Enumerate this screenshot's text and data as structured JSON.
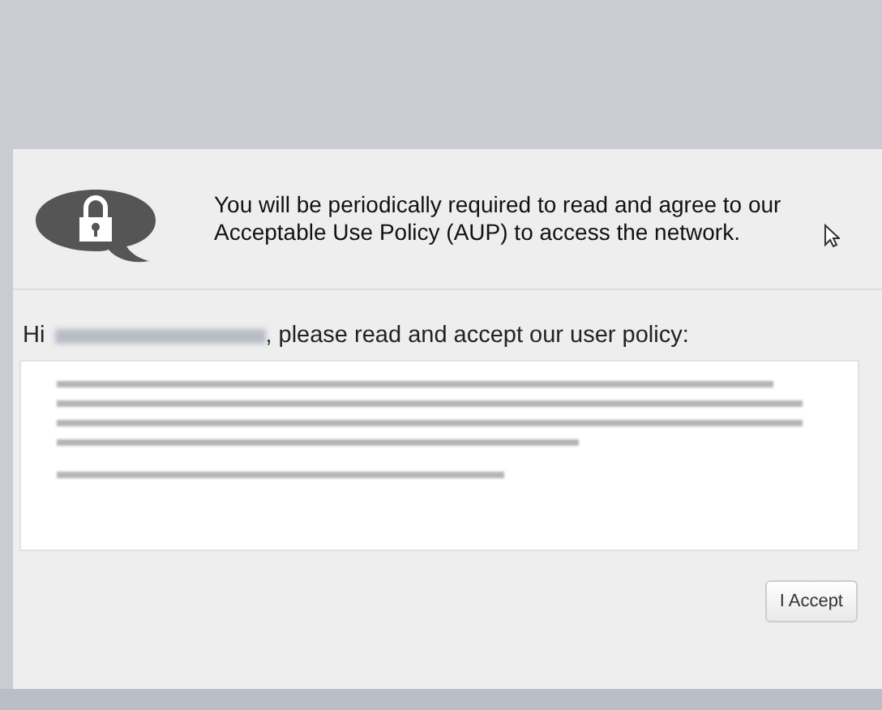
{
  "notice": {
    "text": "You will be periodically required to read and agree to our Acceptable Use Policy (AUP) to access the network."
  },
  "greeting": {
    "before": "Hi",
    "after": ", please read and accept our user policy:"
  },
  "buttons": [
    {
      "label": "I Accept"
    }
  ]
}
